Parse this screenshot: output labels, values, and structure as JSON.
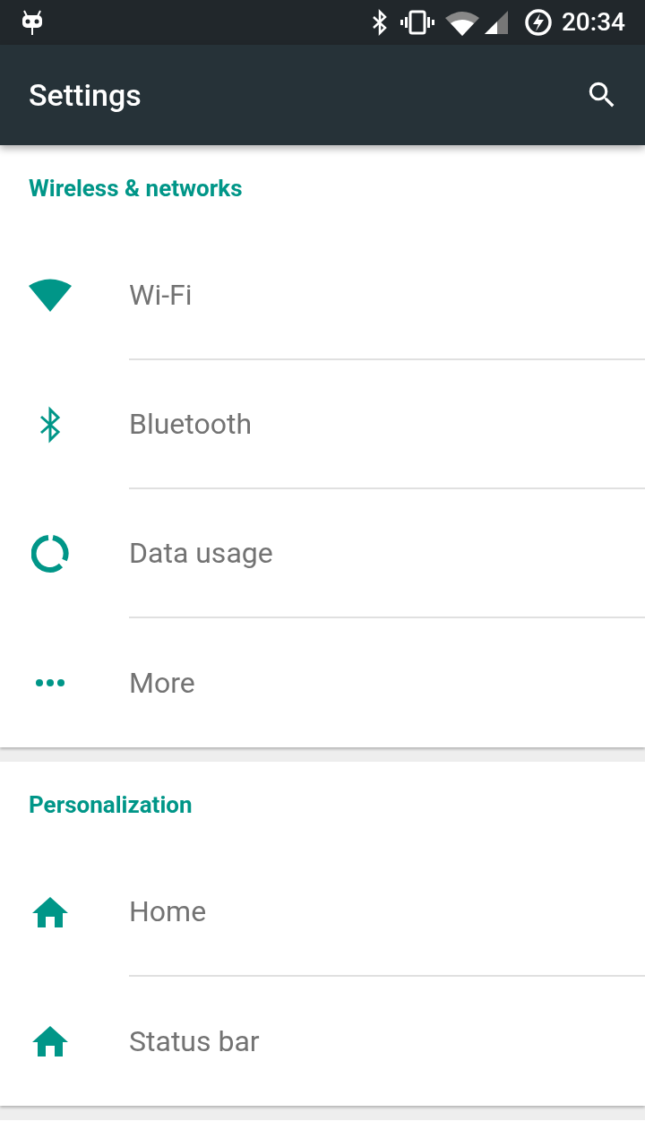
{
  "status_bar": {
    "time": "20:34"
  },
  "app_bar": {
    "title": "Settings"
  },
  "sections": [
    {
      "title": "Wireless & networks",
      "items": [
        {
          "kind": "wifi",
          "label": "Wi-Fi"
        },
        {
          "kind": "bluetooth",
          "label": "Bluetooth"
        },
        {
          "kind": "data",
          "label": "Data usage"
        },
        {
          "kind": "more",
          "label": "More"
        }
      ]
    },
    {
      "title": "Personalization",
      "items": [
        {
          "kind": "home",
          "label": "Home"
        },
        {
          "kind": "home",
          "label": "Status bar"
        }
      ]
    }
  ]
}
